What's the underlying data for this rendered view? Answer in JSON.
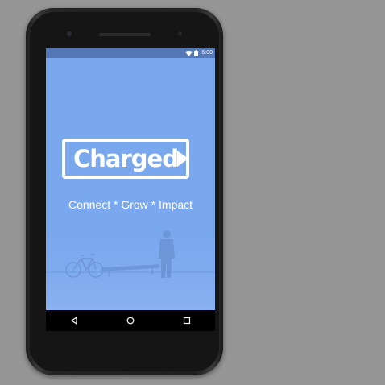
{
  "device": {
    "model_icons": [
      "earpiece",
      "front-camera",
      "sensor"
    ]
  },
  "status_bar": {
    "time": "6:00",
    "icons": [
      "wifi-icon",
      "battery-icon"
    ]
  },
  "app": {
    "logo_text": "Charged",
    "tagline": "Connect * Grow * Impact",
    "background_color": "#7aa8ef",
    "status_bar_color": "#5477b6"
  },
  "nav_bar": {
    "buttons": [
      "back",
      "home",
      "recents"
    ]
  }
}
